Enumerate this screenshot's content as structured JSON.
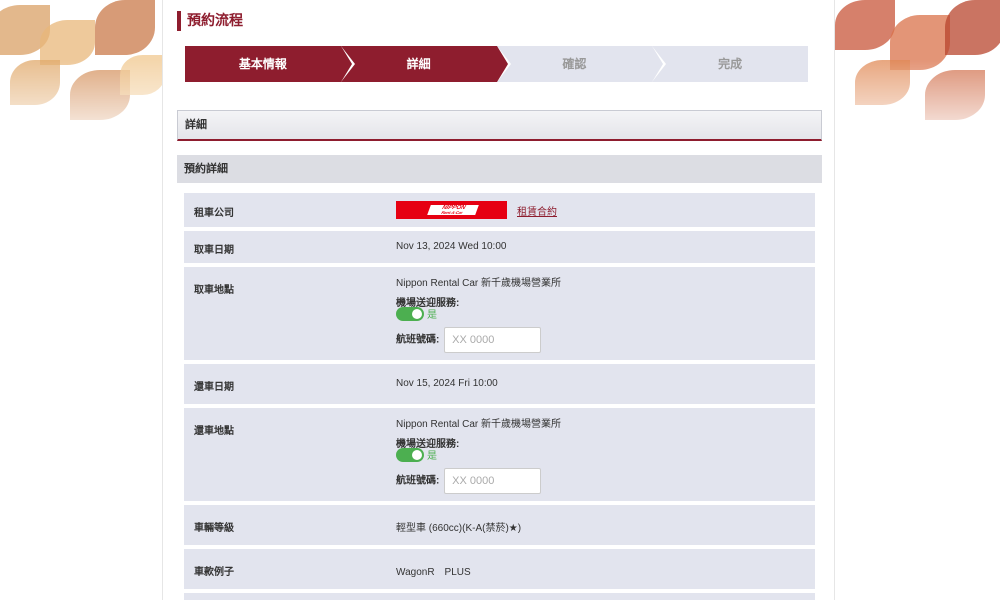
{
  "page_title": "預約流程",
  "steps": [
    {
      "label": "基本情報",
      "active": true
    },
    {
      "label": "詳細",
      "active": true
    },
    {
      "label": "確認",
      "active": false
    },
    {
      "label": "完成",
      "active": false
    }
  ],
  "section_title": "詳細",
  "sub_title": "預約詳細",
  "rental_company": {
    "label": "租車公司",
    "logo_text": "NIPPON",
    "logo_subtext": "Rent-A-Car",
    "link": "租賃合約"
  },
  "pickup_date": {
    "label": "取車日期",
    "value": "Nov 13, 2024 Wed 10:00"
  },
  "pickup_location": {
    "label": "取車地點",
    "value": "Nippon Rental Car 新千歲機場營業所",
    "shuttle_label": "機場送迎服務:",
    "shuttle_value": "是",
    "flight_label": "航班號碼:",
    "flight_placeholder": "XX 0000"
  },
  "return_date": {
    "label": "還車日期",
    "value": "Nov 15, 2024 Fri 10:00"
  },
  "return_location": {
    "label": "還車地點",
    "value": "Nippon Rental Car 新千歲機場營業所",
    "shuttle_label": "機場送迎服務:",
    "shuttle_value": "是",
    "flight_label": "航班號碼:",
    "flight_placeholder": "XX 0000"
  },
  "car_class": {
    "label": "車輛等級",
    "value": "輕型車 (660cc)(K-A(禁菸)★)"
  },
  "car_example": {
    "label": "車款例子",
    "value": "WagonR　PLUS"
  },
  "colors": {
    "brand": "#8e1d2e",
    "row_bg": "#e2e4ee",
    "toggle_on": "#4caf50"
  }
}
